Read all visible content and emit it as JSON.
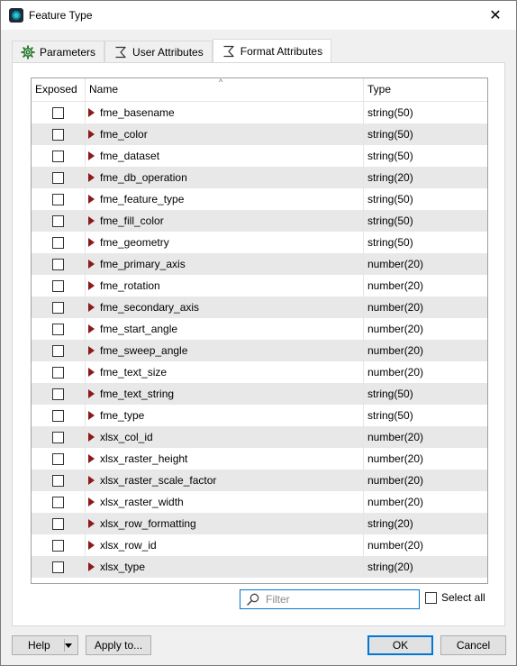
{
  "window": {
    "title": "Feature Type",
    "close_glyph": "✕"
  },
  "tabs": [
    {
      "label": "Parameters",
      "icon": "gear-icon",
      "active": false
    },
    {
      "label": "User Attributes",
      "icon": "sigma-icon",
      "active": false
    },
    {
      "label": "Format Attributes",
      "icon": "sigma-icon",
      "active": true
    }
  ],
  "table": {
    "headers": {
      "exposed": "Exposed",
      "name": "Name",
      "type": "Type"
    },
    "sort_indicator": "^",
    "rows": [
      {
        "name": "fme_basename",
        "type": "string(50)"
      },
      {
        "name": "fme_color",
        "type": "string(50)"
      },
      {
        "name": "fme_dataset",
        "type": "string(50)"
      },
      {
        "name": "fme_db_operation",
        "type": "string(20)"
      },
      {
        "name": "fme_feature_type",
        "type": "string(50)"
      },
      {
        "name": "fme_fill_color",
        "type": "string(50)"
      },
      {
        "name": "fme_geometry",
        "type": "string(50)"
      },
      {
        "name": "fme_primary_axis",
        "type": "number(20)"
      },
      {
        "name": "fme_rotation",
        "type": "number(20)"
      },
      {
        "name": "fme_secondary_axis",
        "type": "number(20)"
      },
      {
        "name": "fme_start_angle",
        "type": "number(20)"
      },
      {
        "name": "fme_sweep_angle",
        "type": "number(20)"
      },
      {
        "name": "fme_text_size",
        "type": "number(20)"
      },
      {
        "name": "fme_text_string",
        "type": "string(50)"
      },
      {
        "name": "fme_type",
        "type": "string(50)"
      },
      {
        "name": "xlsx_col_id",
        "type": "number(20)"
      },
      {
        "name": "xlsx_raster_height",
        "type": "number(20)"
      },
      {
        "name": "xlsx_raster_scale_factor",
        "type": "number(20)"
      },
      {
        "name": "xlsx_raster_width",
        "type": "number(20)"
      },
      {
        "name": "xlsx_row_formatting",
        "type": "string(20)"
      },
      {
        "name": "xlsx_row_id",
        "type": "number(20)"
      },
      {
        "name": "xlsx_type",
        "type": "string(20)"
      }
    ]
  },
  "filter": {
    "placeholder": "Filter",
    "select_all_label": "Select all"
  },
  "buttons": {
    "help": "Help",
    "apply": "Apply to...",
    "ok": "OK",
    "cancel": "Cancel"
  },
  "colors": {
    "accent": "#0078d7",
    "expand_arrow": "#8b1a1a",
    "alt_row": "#e8e8e8"
  }
}
